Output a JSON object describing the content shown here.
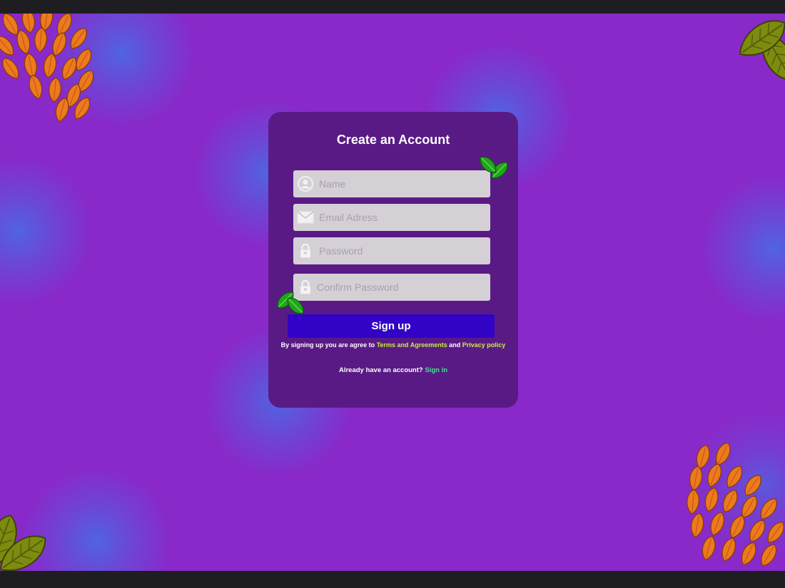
{
  "form": {
    "title": "Create an Account",
    "fields": [
      {
        "icon": "user-icon",
        "placeholder": "Name",
        "value": ""
      },
      {
        "icon": "envelope-icon",
        "placeholder": "Email Adress",
        "value": ""
      },
      {
        "icon": "lock-icon",
        "placeholder": "Password",
        "value": ""
      },
      {
        "icon": "lock-icon",
        "placeholder": "Confirm Password",
        "value": ""
      }
    ],
    "signup_label": "Sign up",
    "terms_prefix": "By signing up you are agree to",
    "terms_link": "Terms and Agreements",
    "terms_and": "and",
    "privacy_link": "Privacy policy",
    "signin_prefix": "Already have an account?",
    "signin_link": "Sign in"
  },
  "colors": {
    "background": "#8929c9",
    "blob": "#4f74e0",
    "card": "#5a1a86",
    "field": "#d5d0d6",
    "button": "#3203c6",
    "terms_link": "#c7f03a",
    "signin_link": "#3fe88a",
    "orange_leaves": "#e8741c",
    "olive_leaves": "#7e8a10",
    "green_leaf": "#1fa81c"
  }
}
